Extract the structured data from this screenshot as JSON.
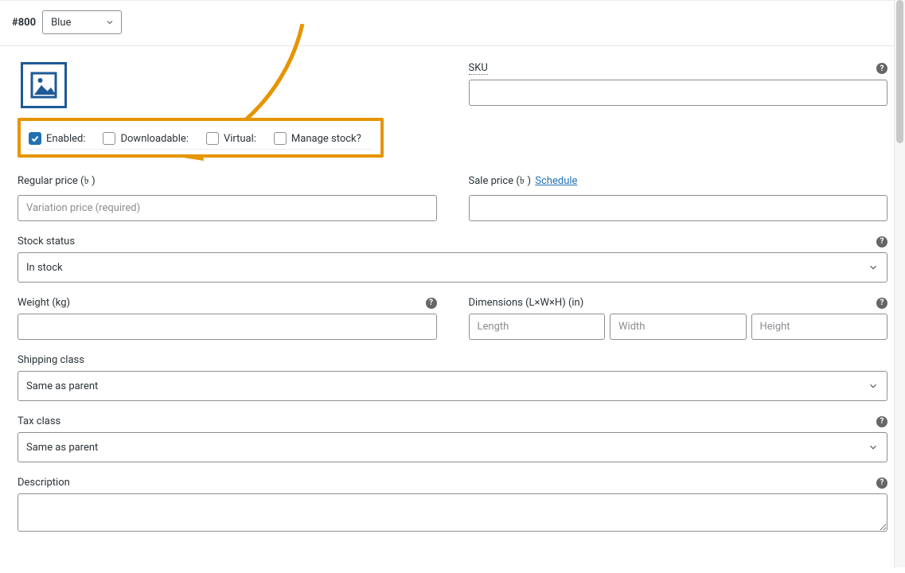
{
  "header": {
    "variation_id": "#800",
    "attribute_value": "Blue"
  },
  "checkboxes": {
    "enabled": {
      "label": "Enabled:",
      "checked": true
    },
    "downloadable": {
      "label": "Downloadable:",
      "checked": false
    },
    "virtual": {
      "label": "Virtual:",
      "checked": false
    },
    "manage_stock": {
      "label": "Manage stock?",
      "checked": false
    }
  },
  "sku": {
    "label": "SKU",
    "value": ""
  },
  "regular_price": {
    "label": "Regular price (৳ )",
    "placeholder": "Variation price (required)",
    "value": ""
  },
  "sale_price": {
    "label": "Sale price (৳ )",
    "schedule": "Schedule",
    "value": ""
  },
  "stock_status": {
    "label": "Stock status",
    "value": "In stock"
  },
  "weight": {
    "label": "Weight (kg)",
    "value": ""
  },
  "dimensions": {
    "label": "Dimensions (L×W×H) (in)",
    "length_ph": "Length",
    "width_ph": "Width",
    "height_ph": "Height",
    "length": "",
    "width": "",
    "height": ""
  },
  "shipping_class": {
    "label": "Shipping class",
    "value": "Same as parent"
  },
  "tax_class": {
    "label": "Tax class",
    "value": "Same as parent"
  },
  "description": {
    "label": "Description",
    "value": ""
  },
  "icons": {
    "help": "?"
  }
}
